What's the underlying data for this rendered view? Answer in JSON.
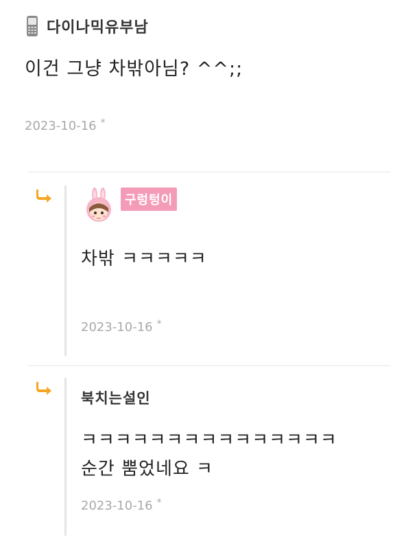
{
  "top_comment": {
    "author": "다이나믹유부남",
    "author_icon": "phone-icon",
    "text": "이건 그냥 차밖아님? ^^;;",
    "date": "2023-10-16",
    "star": "*"
  },
  "replies": [
    {
      "arrow_icon": "reply-arrow-icon",
      "avatar_icon": "pink-bunny-avatar",
      "nickname": "구렁텅이",
      "badge_color": "#f49bb8",
      "text": "차밖 ㅋㅋㅋㅋㅋ",
      "date": "2023-10-16",
      "star": "*"
    },
    {
      "arrow_icon": "reply-arrow-icon",
      "author": "북치는설인",
      "text_line1": "ㅋㅋㅋㅋㅋㅋㅋㅋㅋㅋㅋㅋㅋㅋㅋ",
      "text_line2": "순간 뿜었네요 ㅋ",
      "date": "2023-10-16",
      "star": "*"
    }
  ],
  "colors": {
    "arrow": "#f5a623",
    "timestamp": "#a8a8a8",
    "divider": "#e6e6e6"
  }
}
